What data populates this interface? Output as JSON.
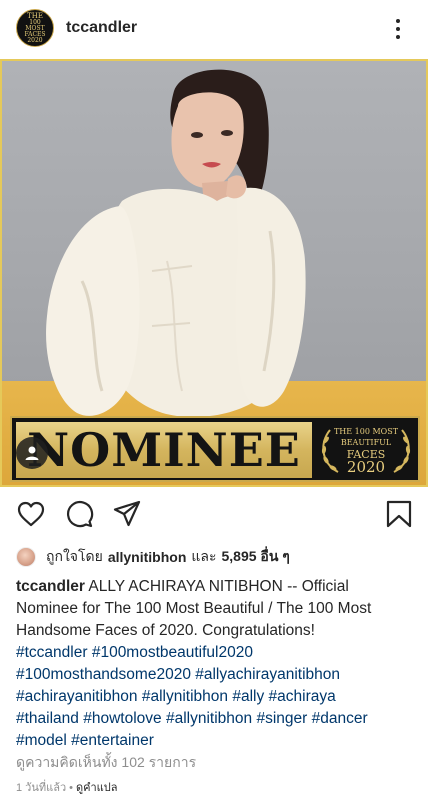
{
  "post": {
    "username": "tccandler",
    "avatar_lines": [
      "THE",
      "100",
      "MOST",
      "FACES"
    ],
    "avatar_year": "2020"
  },
  "image": {
    "banner_text": "NOMINEE",
    "badge_line1": "THE 100 MOST",
    "badge_line2": "BEAUTIFUL",
    "badge_line3": "FACES",
    "badge_year": "2020",
    "accent_gold": "#caa94c",
    "floor_color": "#e1ad42"
  },
  "icons": {
    "like": "heart-outline-icon",
    "comment": "comment-bubble-icon",
    "share": "paper-plane-icon",
    "save": "bookmark-icon",
    "more": "more-vertical-icon",
    "tagged": "user-tag-icon"
  },
  "likes": {
    "prefix": "ถูกใจโดย",
    "user": "allynitibhon",
    "and": "และ",
    "count": "5,895 อื่น ๆ"
  },
  "caption": {
    "user": "tccandler",
    "line1_text": " ALLY ACHIRAYA NITIBHON -- Official",
    "line2": "Nominee for The 100 Most Beautiful / The 100 Most",
    "line3": "Handsome Faces of 2020.  Congratulations!",
    "hashtags": [
      [
        "#tccandler",
        "#100mostbeautiful2020"
      ],
      [
        "#100mosthandsome2020",
        "#allyachirayanitibhon"
      ],
      [
        "#achirayanitibhon",
        "#allynitibhon",
        "#ally",
        "#achiraya"
      ],
      [
        "#thailand",
        "#howtolove",
        "#allynitibhon",
        "#singer",
        "#dancer"
      ],
      [
        "#model",
        "#entertainer"
      ]
    ]
  },
  "comments_link": "ดูความคิดเห็นทั้ง 102 รายการ",
  "meta": {
    "time": "1 วันที่แล้ว",
    "separator": "•",
    "translate": "ดูคำแปล"
  }
}
